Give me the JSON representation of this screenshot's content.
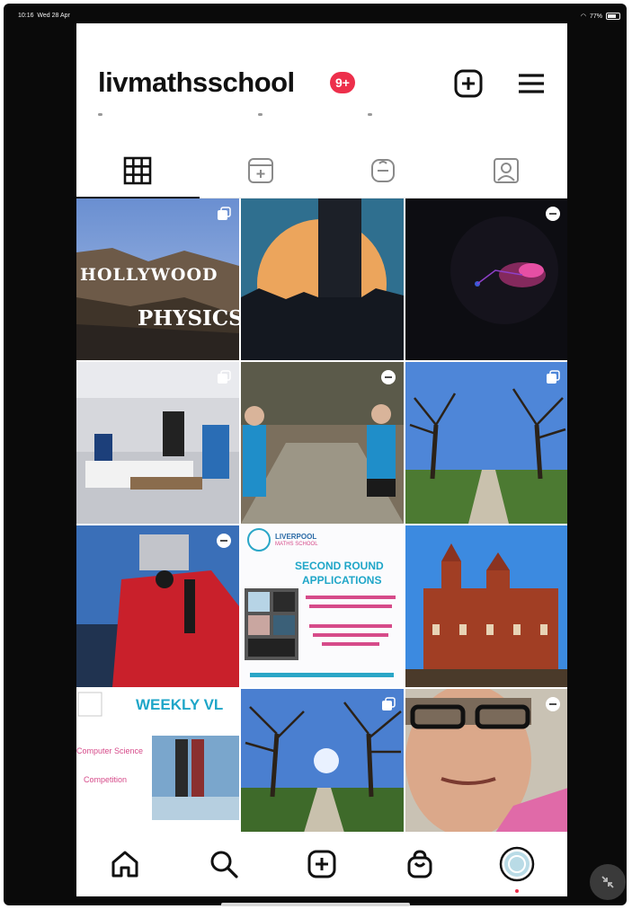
{
  "status_bar": {
    "time": "10:16",
    "date": "Wed 28 Apr",
    "battery": "77%"
  },
  "header": {
    "username": "livmathsschool",
    "notification_badge": "9+",
    "add_icon": "plus-square-icon",
    "menu_icon": "hamburger-menu-icon"
  },
  "tabs": [
    {
      "name": "grid",
      "icon": "grid-icon",
      "active": true
    },
    {
      "name": "reels",
      "icon": "reels-icon",
      "active": false
    },
    {
      "name": "guides",
      "icon": "guide-icon",
      "active": false
    },
    {
      "name": "tagged",
      "icon": "tagged-person-icon",
      "active": false
    }
  ],
  "posts": [
    {
      "caption_text": [
        "HOLLYWOOD",
        "PHYSICS"
      ],
      "type": "carousel"
    },
    {
      "caption_text": [],
      "type": "photo"
    },
    {
      "caption_text": [],
      "type": "reel"
    },
    {
      "caption_text": [],
      "type": "carousel"
    },
    {
      "caption_text": [],
      "type": "reel"
    },
    {
      "caption_text": [],
      "type": "carousel"
    },
    {
      "caption_text": [],
      "type": "reel"
    },
    {
      "caption_text": [
        "LIVERPOOL",
        "MATHS SCHOOL",
        "SECOND ROUND",
        "APPLICATIONS"
      ],
      "type": "photo"
    },
    {
      "caption_text": [],
      "type": "photo"
    },
    {
      "caption_text": [
        "WEEKLY VL",
        "Computer Science",
        "Competition"
      ],
      "type": "photo"
    },
    {
      "caption_text": [],
      "type": "carousel"
    },
    {
      "caption_text": [],
      "type": "reel"
    }
  ],
  "bottom_nav": [
    {
      "name": "home",
      "icon": "home-icon"
    },
    {
      "name": "search",
      "icon": "search-icon"
    },
    {
      "name": "create",
      "icon": "plus-square-icon"
    },
    {
      "name": "shop",
      "icon": "shopping-bag-icon"
    },
    {
      "name": "profile",
      "icon": "avatar-icon"
    }
  ],
  "colors": {
    "badge": "#ed2f4b",
    "text": "#111111",
    "bezel": "#0a0a0a"
  }
}
